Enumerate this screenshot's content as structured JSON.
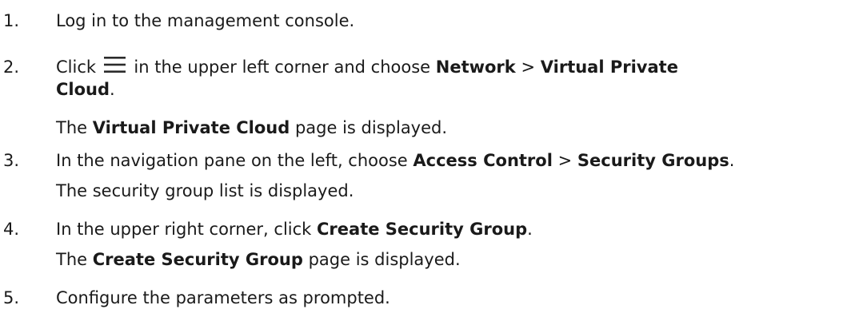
{
  "steps": [
    {
      "number": "1.",
      "text": "Log in to the management console."
    },
    {
      "number": "2.",
      "pre": "Click",
      "icon": "menu-icon",
      "mid": "in the upper left corner and choose",
      "b1": "Network",
      "sep": ">",
      "b2a": "Virtual Private",
      "b2b": "Cloud",
      "end": ".",
      "result_b": "Virtual Private Cloud",
      "result_rest": "page is displayed."
    },
    {
      "number": "3.",
      "pre": "In the navigation pane on the left, choose",
      "b1": "Access Control",
      "sep": ">",
      "b2": "Security Groups",
      "end": ".",
      "result": "The security group list is displayed."
    },
    {
      "number": "4.",
      "pre": "In the upper right corner, click",
      "b1": "Create Security Group",
      "end": ".",
      "result_pre": "The",
      "result_b": "Create Security Group",
      "result_rest": "page is displayed."
    },
    {
      "number": "5.",
      "text": "Configure the parameters as prompted."
    }
  ],
  "colors": {
    "text": "#1a1a1a",
    "icon": "#2b2b2b"
  }
}
